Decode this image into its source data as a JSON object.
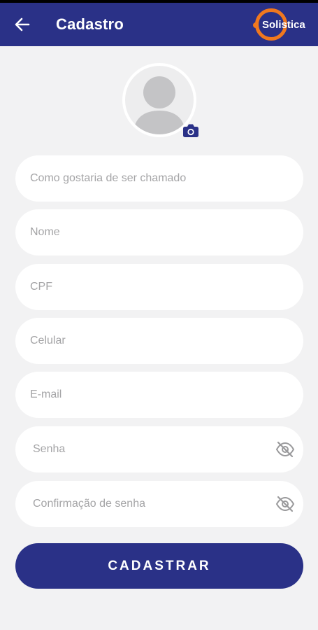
{
  "appbar": {
    "title": "Cadastro",
    "back_icon": "arrow-left-icon",
    "brand": "Solistica",
    "color": "#2a3187",
    "brand_accent": "#f0781e"
  },
  "profile": {
    "avatar_icon": "user-placeholder-icon",
    "camera_icon": "camera-icon"
  },
  "form": {
    "nickname_placeholder": "Como gostaria de ser chamado",
    "name_placeholder": "Nome",
    "cpf_placeholder": "CPF",
    "phone_placeholder": "Celular",
    "email_placeholder": "E-mail",
    "password_placeholder": "Senha",
    "password_confirm_placeholder": "Confirmação de senha",
    "visibility_icon": "eye-off-icon"
  },
  "submit_label": "CADASTRAR"
}
